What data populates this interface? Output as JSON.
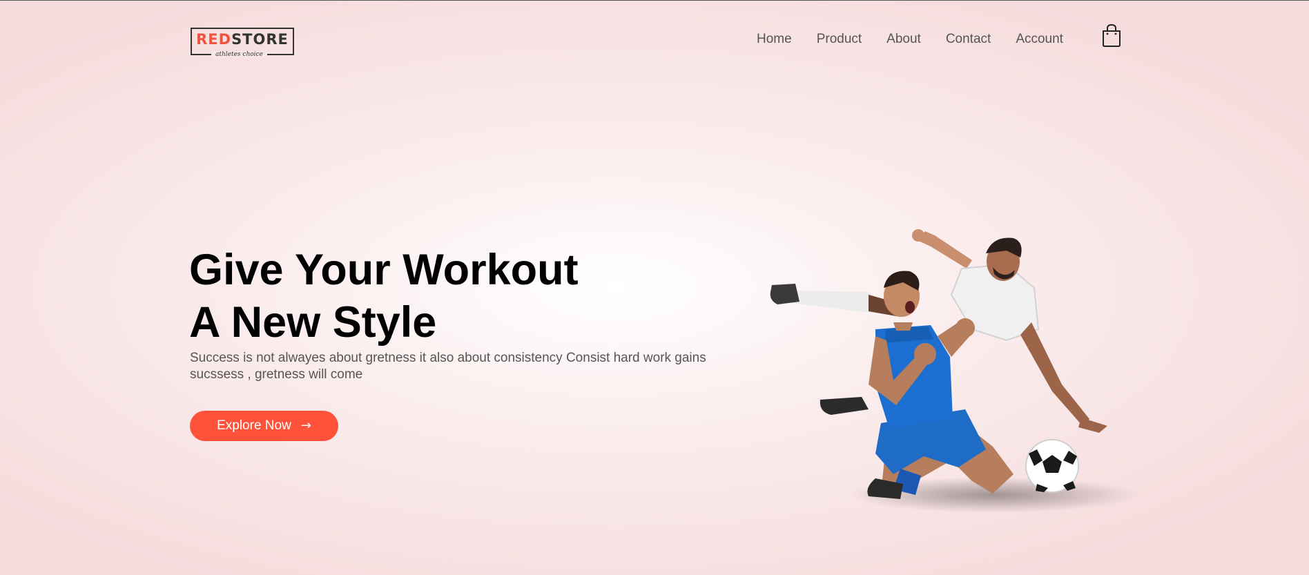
{
  "header": {
    "logo": {
      "red_part": "RED",
      "dark_part": "STORE",
      "tagline": "athletes choice"
    },
    "nav": [
      {
        "label": "Home"
      },
      {
        "label": "Product"
      },
      {
        "label": "About"
      },
      {
        "label": "Contact"
      },
      {
        "label": "Account"
      }
    ],
    "cart_icon": "shopping-bag-icon"
  },
  "hero": {
    "title_line_1": "Give Your Workout",
    "title_line_2": "A New Style",
    "description": "Success is not alwayes about gretness it also about consistency Consist hard work gains sucssess , gretness will come",
    "button_label": "Explore Now",
    "button_icon": "arrow-right-icon",
    "image": "soccer-players-celebrating-image"
  },
  "colors": {
    "accent": "#ff523b",
    "text_dark": "#000000",
    "text_muted": "#555555",
    "background": "#f6dcdd"
  }
}
